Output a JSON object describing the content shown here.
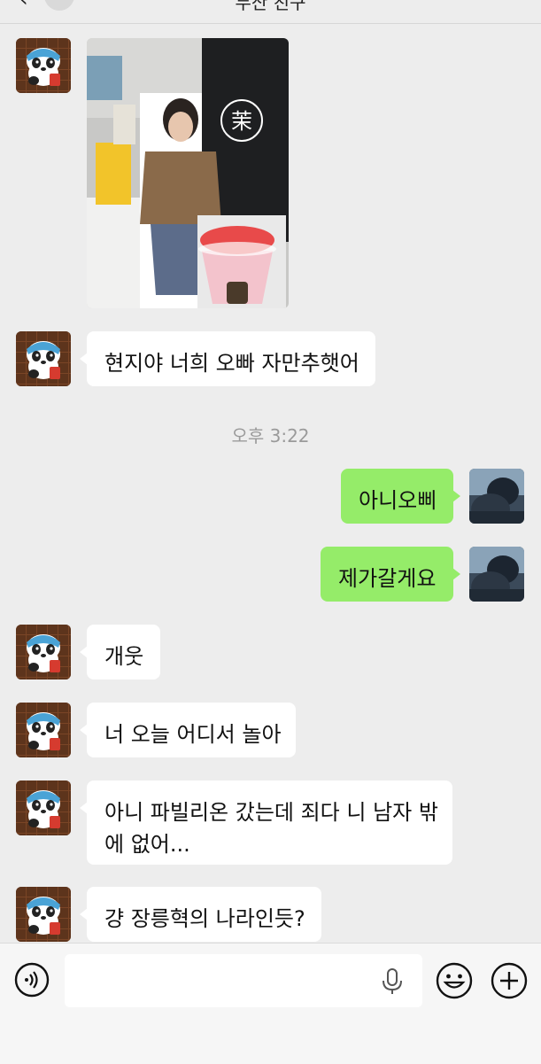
{
  "header": {
    "title": "두산 친구"
  },
  "timestamp": "오후 3:22",
  "messages": [
    {
      "text": "현지야 너희 오빠 자만추햇어"
    },
    {
      "text": "아니오삐"
    },
    {
      "text": "제가갈게요"
    },
    {
      "text": "개웃"
    },
    {
      "text": "너 오늘 어디서 놀아"
    },
    {
      "line1": "아니 파빌리온 갔는데 죄다 니 남자 밖",
      "line2": "에 없어..."
    },
    {
      "text": "걍 장릉혁의 나라인듯?"
    }
  ],
  "photo": {
    "sign_char": "茉"
  },
  "input": {
    "placeholder": ""
  },
  "colors": {
    "background": "#ededed",
    "outgoing_bubble": "#95ec69",
    "incoming_bubble": "#ffffff",
    "timestamp": "#9a9a9a"
  },
  "icons": [
    "back-arrow-icon",
    "voice-icon",
    "microphone-icon",
    "emoji-icon",
    "plus-icon",
    "panda-avatar",
    "dark-photo-avatar"
  ]
}
